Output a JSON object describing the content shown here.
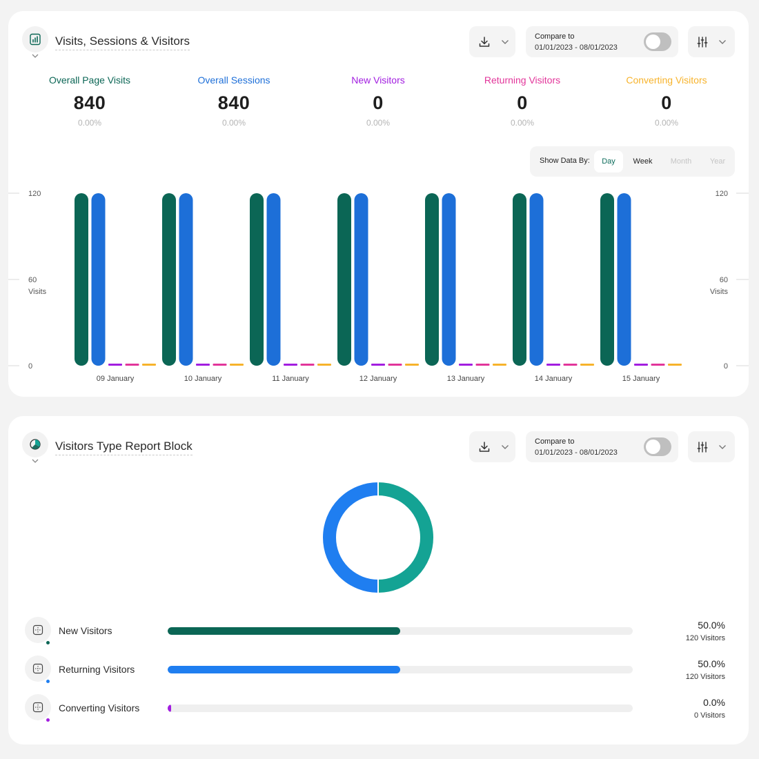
{
  "card1": {
    "title": "Visits, Sessions & Visitors",
    "icon": "bar-chart-icon",
    "compare": {
      "label": "Compare to",
      "range": "01/01/2023 - 08/01/2023",
      "enabled": false
    },
    "stats": [
      {
        "label": "Overall Page Visits",
        "value": "840",
        "change": "0.00%",
        "color": "#0b6655"
      },
      {
        "label": "Overall Sessions",
        "value": "840",
        "change": "0.00%",
        "color": "#1d6fd8"
      },
      {
        "label": "New Visitors",
        "value": "0",
        "change": "0.00%",
        "color": "#a21ee0"
      },
      {
        "label": "Returning Visitors",
        "value": "0",
        "change": "0.00%",
        "color": "#e2359a"
      },
      {
        "label": "Converting Visitors",
        "value": "0",
        "change": "0.00%",
        "color": "#f7b32b"
      }
    ],
    "show_data_by": {
      "label": "Show Data By:",
      "options": [
        "Day",
        "Week",
        "Month",
        "Year"
      ],
      "selected": "Day",
      "disabled": [
        "Month",
        "Year"
      ]
    }
  },
  "chart_data": {
    "type": "bar",
    "categories": [
      "09 January",
      "10 January",
      "11 January",
      "12 January",
      "13 January",
      "14 January",
      "15 January"
    ],
    "series": [
      {
        "name": "Overall Page Visits",
        "color": "#0b6655",
        "values": [
          120,
          120,
          120,
          120,
          120,
          120,
          120
        ]
      },
      {
        "name": "Overall Sessions",
        "color": "#1d6fd8",
        "values": [
          120,
          120,
          120,
          120,
          120,
          120,
          120
        ]
      },
      {
        "name": "New Visitors",
        "color": "#a21ee0",
        "values": [
          0,
          0,
          0,
          0,
          0,
          0,
          0
        ]
      },
      {
        "name": "Returning Visitors",
        "color": "#e2359a",
        "values": [
          0,
          0,
          0,
          0,
          0,
          0,
          0
        ]
      },
      {
        "name": "Converting Visitors",
        "color": "#f7b32b",
        "values": [
          0,
          0,
          0,
          0,
          0,
          0,
          0
        ]
      }
    ],
    "ylim": [
      0,
      120
    ],
    "yticks": [
      "120",
      "60",
      "0"
    ],
    "ylabel": "Visits",
    "y_axes": "left-and-right",
    "legend": "none"
  },
  "card2": {
    "title": "Visitors Type Report Block",
    "icon": "pie-chart-icon",
    "compare": {
      "label": "Compare to",
      "range": "01/01/2023 - 08/01/2023",
      "enabled": false
    },
    "donut": [
      {
        "name": "New Visitors",
        "value": 50,
        "color": "#14a394"
      },
      {
        "name": "Returning Visitors",
        "value": 50,
        "color": "#1f7ef0"
      }
    ],
    "rows": [
      {
        "name": "New Visitors",
        "percent": "50.0%",
        "count": "120 Visitors",
        "fraction": 0.5,
        "color": "#0b6655",
        "dot": "#0b6655"
      },
      {
        "name": "Returning Visitors",
        "percent": "50.0%",
        "count": "120 Visitors",
        "fraction": 0.5,
        "color": "#1f7ef0",
        "dot": "#1f7ef0"
      },
      {
        "name": "Converting Visitors",
        "percent": "0.0%",
        "count": "0 Visitors",
        "fraction": 0,
        "color": "#a21ee0",
        "dot": "#a21ee0"
      }
    ]
  }
}
